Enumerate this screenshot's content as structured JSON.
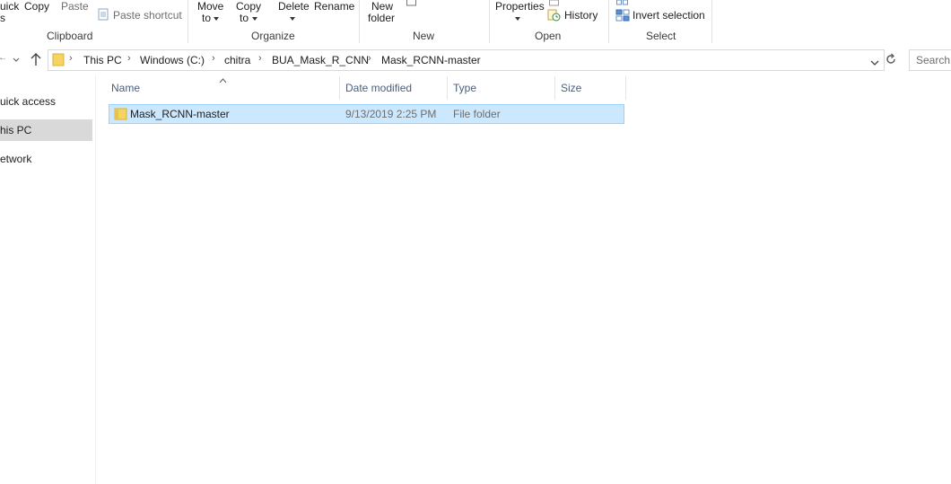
{
  "ribbon": {
    "clipboard": {
      "quick_access_label_1": "uick",
      "quick_access_label_2": "s",
      "copy_label": "Copy",
      "paste_label": "Paste",
      "paste_shortcut_label": "Paste shortcut",
      "group_label": "Clipboard"
    },
    "organize": {
      "move_to_label_1": "Move",
      "move_to_label_2": "to",
      "copy_to_label_1": "Copy",
      "copy_to_label_2": "to",
      "delete_label": "Delete",
      "rename_label": "Rename",
      "group_label": "Organize"
    },
    "new": {
      "new_folder_label_1": "New",
      "new_folder_label_2": "folder",
      "group_label": "New"
    },
    "open": {
      "properties_label": "Properties",
      "history_label": "History",
      "group_label": "Open"
    },
    "select": {
      "invert_selection_label": "Invert selection",
      "group_label": "Select"
    }
  },
  "address_bar": {
    "breadcrumbs": [
      "This PC",
      "Windows (C:)",
      "chitra",
      "BUA_Mask_R_CNN",
      "Mask_RCNN-master"
    ]
  },
  "search": {
    "placeholder": "Search"
  },
  "nav_pane": {
    "items": [
      {
        "label": "uick access",
        "selected": false
      },
      {
        "label": "his PC",
        "selected": true
      },
      {
        "label": "etwork",
        "selected": false
      }
    ]
  },
  "file_list": {
    "columns": [
      "Name",
      "Date modified",
      "Type",
      "Size"
    ],
    "rows": [
      {
        "name": "Mask_RCNN-master",
        "date_modified": "9/13/2019 2:25 PM",
        "type": "File folder",
        "size": ""
      }
    ]
  },
  "icons": {
    "folder_color": "#f5d463",
    "selection_color": "#cce8ff"
  }
}
